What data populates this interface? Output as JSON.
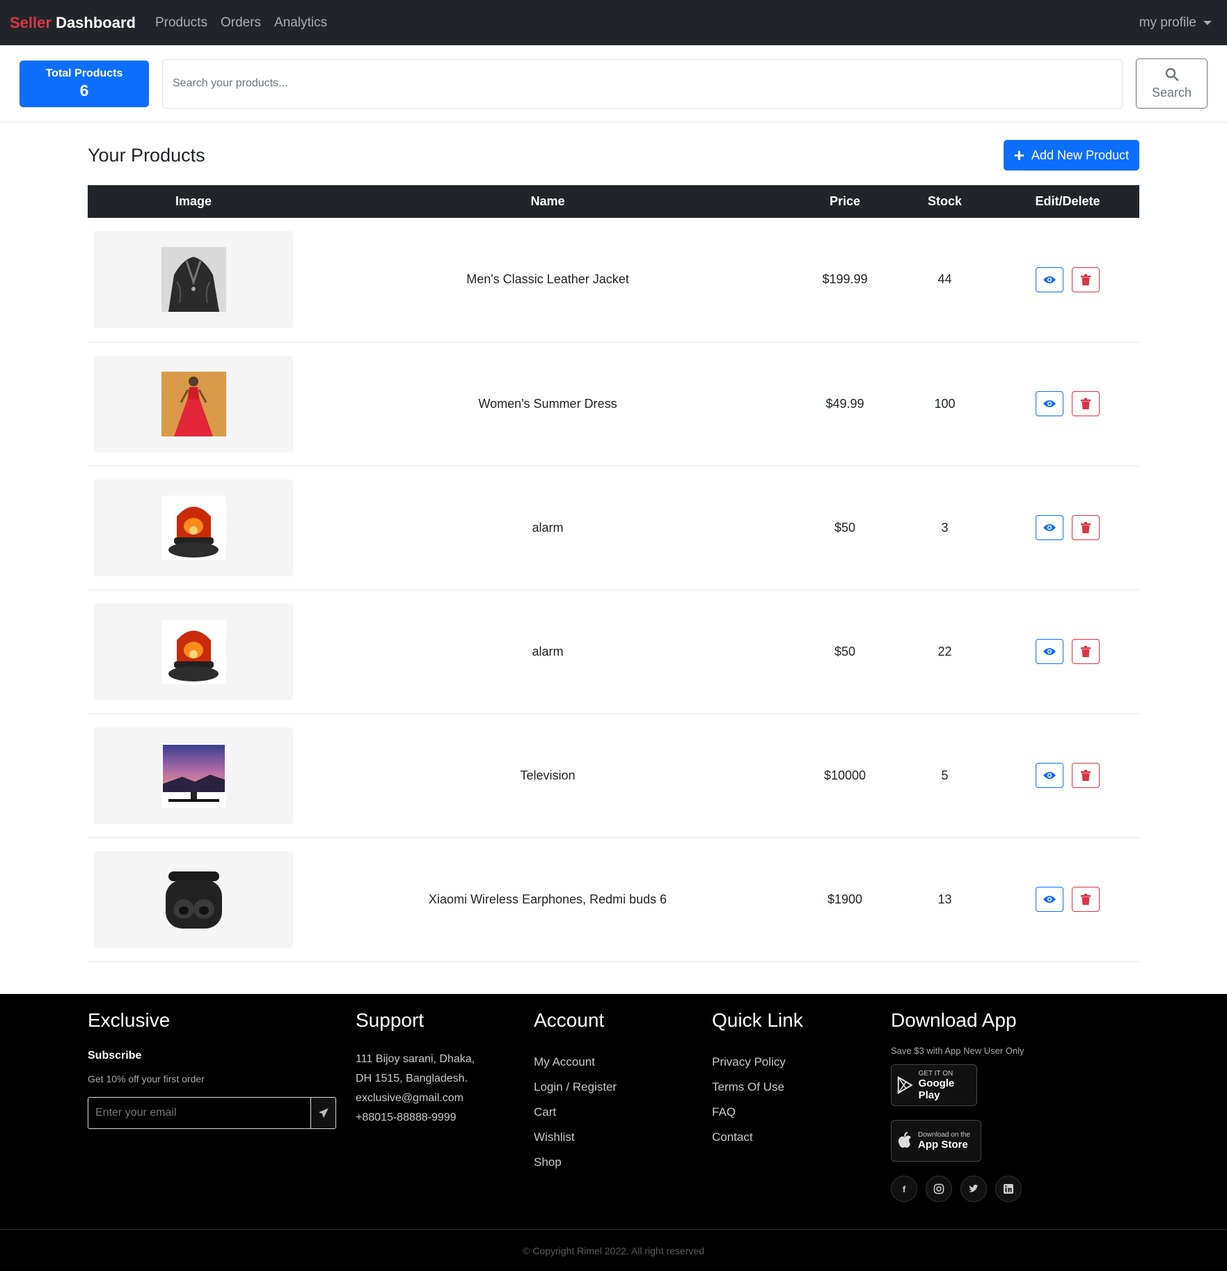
{
  "navbar": {
    "brand_part1": "Seller",
    "brand_part2": "Dashboard",
    "links": [
      "Products",
      "Orders",
      "Analytics"
    ],
    "profile": "my profile"
  },
  "summary": {
    "total_label": "Total Products",
    "total_value": "6"
  },
  "search": {
    "placeholder": "Search your products...",
    "button_label": "Search",
    "icon": "search-icon"
  },
  "products_section": {
    "title": "Your Products",
    "add_button": "Add New Product"
  },
  "table": {
    "headers": [
      "Image",
      "Name",
      "Price",
      "Stock",
      "Edit/Delete"
    ],
    "rows": [
      {
        "name": "Men's Classic Leather Jacket",
        "price": "$199.99",
        "stock": "44",
        "image": "leather-jacket-image"
      },
      {
        "name": "Women's Summer Dress",
        "price": "$49.99",
        "stock": "100",
        "image": "summer-dress-image"
      },
      {
        "name": "alarm",
        "price": "$50",
        "stock": "3",
        "image": "alarm-light-image"
      },
      {
        "name": "alarm",
        "price": "$50",
        "stock": "22",
        "image": "alarm-light-image"
      },
      {
        "name": "Television",
        "price": "$10000",
        "stock": "5",
        "image": "television-image"
      },
      {
        "name": "Xiaomi Wireless Earphones, Redmi buds 6",
        "price": "$1900",
        "stock": "13",
        "image": "earbuds-image"
      }
    ]
  },
  "footer": {
    "exclusive": {
      "title": "Exclusive",
      "subscribe": "Subscribe",
      "offer": "Get 10% off your first order",
      "email_placeholder": "Enter your email"
    },
    "support": {
      "title": "Support",
      "address_line1": "111 Bijoy sarani, Dhaka,",
      "address_line2": "DH 1515, Bangladesh.",
      "email": "exclusive@gmail.com",
      "phone": "+88015-88888-9999"
    },
    "account": {
      "title": "Account",
      "links": [
        "My Account",
        "Login / Register",
        "Cart",
        "Wishlist",
        "Shop"
      ]
    },
    "quick_link": {
      "title": "Quick Link",
      "links": [
        "Privacy Policy",
        "Terms Of Use",
        "FAQ",
        "Contact"
      ]
    },
    "download": {
      "title": "Download App",
      "note": "Save $3 with App New User Only",
      "google_small": "GET IT ON",
      "google_big": "Google Play",
      "apple_small": "Download on the",
      "apple_big": "App Store"
    },
    "socials": [
      "facebook-icon",
      "instagram-icon",
      "twitter-icon",
      "linkedin-icon"
    ],
    "copyright": "© Copyright Rimel 2022. All right reserved"
  },
  "colors": {
    "primary": "#0d6efd",
    "danger": "#dc3545",
    "dark": "#212529",
    "footer": "#000000"
  }
}
